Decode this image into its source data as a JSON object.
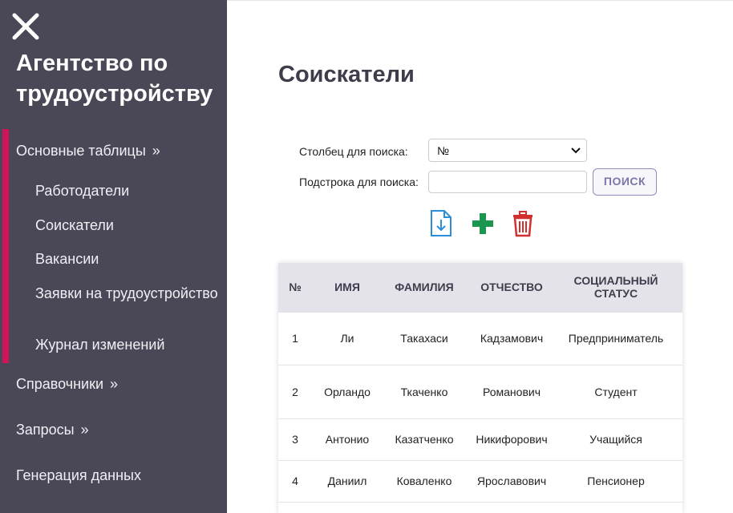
{
  "sidebar": {
    "brand": "Агентство по трудоустройству",
    "sections": [
      {
        "label": "Основные таблицы",
        "chevron": "»"
      },
      {
        "label": "Справочники",
        "chevron": "»"
      },
      {
        "label": "Запросы",
        "chevron": "»"
      },
      {
        "label": "Генерация данных"
      }
    ],
    "items": [
      {
        "label": "Работодатели"
      },
      {
        "label": "Соискатели"
      },
      {
        "label": "Вакансии"
      },
      {
        "label": "Заявки на трудоустройство"
      },
      {
        "label": "Журнал изменений"
      }
    ],
    "accent_color": "#d1145a"
  },
  "main": {
    "title": "Соискатели",
    "search": {
      "column_label": "Столбец для поиска:",
      "column_value": "№",
      "substring_label": "Подстрока для поиска:",
      "substring_value": "",
      "button_label": "ПОИСК"
    },
    "actions": [
      {
        "icon": "download-file-icon",
        "color": "#2a8fd8"
      },
      {
        "icon": "plus-icon",
        "color": "#1a9650"
      },
      {
        "icon": "trash-icon",
        "color": "#d32f2f"
      }
    ],
    "table": {
      "headers": [
        "№",
        "ИМЯ",
        "ФАМИЛИЯ",
        "ОТЧЕСТВО",
        "СОЦИАЛЬНЫЙ СТАТУС"
      ],
      "rows": [
        [
          "1",
          "Ли",
          "Такахаси",
          "Кадзамович",
          "Предприниматель"
        ],
        [
          "2",
          "Орландо",
          "Ткаченко",
          "Романович",
          "Студент"
        ],
        [
          "3",
          "Антонио",
          "Казатченко",
          "Никифорович",
          "Учащийся"
        ],
        [
          "4",
          "Даниил",
          "Коваленко",
          "Ярославович",
          "Пенсионер"
        ]
      ]
    }
  }
}
